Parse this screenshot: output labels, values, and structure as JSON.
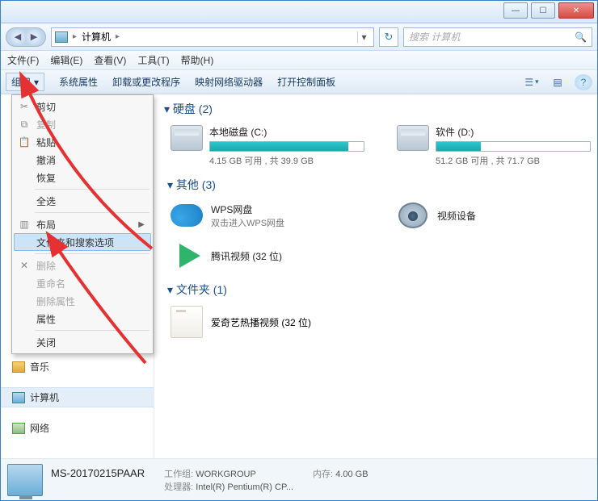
{
  "window": {
    "min_symbol": "—",
    "max_symbol": "☐",
    "close_symbol": "✕"
  },
  "nav": {
    "back": "◀",
    "fwd": "▶",
    "address_label": "计算机",
    "sep": "▸",
    "dropdown": "▾",
    "refresh": "↻",
    "search_placeholder": "搜索 计算机",
    "search_icon": "🔍"
  },
  "menubar": {
    "file": "文件(F)",
    "edit": "编辑(E)",
    "view": "查看(V)",
    "tools": "工具(T)",
    "help": "帮助(H)"
  },
  "toolbar": {
    "organize": "组织",
    "caret": "▾",
    "sysprops": "系统属性",
    "uninstall": "卸载或更改程序",
    "mapdrive": "映射网络驱动器",
    "controlpanel": "打开控制面板",
    "view_icon": "☰",
    "preview_icon": "▤",
    "help_icon": "?"
  },
  "dropdown": {
    "cut": "剪切",
    "copy": "复制",
    "paste": "粘贴",
    "undo": "撤消",
    "redo": "恢复",
    "selectall": "全选",
    "layout": "布局",
    "layout_arrow": "▶",
    "folder_options": "文件夹和搜索选项",
    "delete": "删除",
    "rename": "重命名",
    "remove_props": "删除属性",
    "properties": "属性",
    "close": "关闭"
  },
  "sections": {
    "hdd_title": "硬盘 (2)",
    "other_title": "其他 (3)",
    "folder_title": "文件夹 (1)"
  },
  "drives": {
    "c": {
      "name": "本地磁盘 (C:)",
      "sub": "4.15 GB 可用 , 共 39.9 GB"
    },
    "d": {
      "name": "软件 (D:)",
      "sub": "51.2 GB 可用 , 共 71.7 GB"
    }
  },
  "other": {
    "wps": {
      "t1": "WPS网盘",
      "t2": "双击进入WPS网盘"
    },
    "video": {
      "t1": "视频设备"
    },
    "tencent": {
      "t1": "腾讯视频 (32 位)"
    }
  },
  "folder": {
    "name": "爱奇艺热播视频 (32 位)"
  },
  "sidebar": {
    "music": "音乐",
    "computer": "计算机",
    "network": "网络"
  },
  "status": {
    "name": "MS-20170215PAAR",
    "workgroup_label": "工作组:",
    "workgroup": "WORKGROUP",
    "cpu_label": "处理器:",
    "cpu": "Intel(R) Pentium(R) CP...",
    "mem_label": "内存:",
    "mem": "4.00 GB"
  }
}
